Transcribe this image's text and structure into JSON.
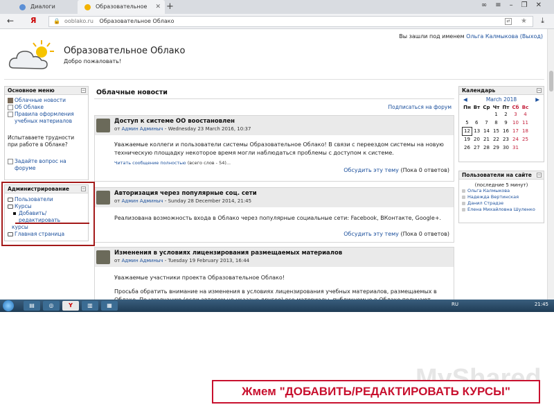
{
  "browser": {
    "tabs": [
      {
        "label": "Диалоги"
      },
      {
        "label": "Образовательное Облако"
      }
    ],
    "address": {
      "brand": "Я",
      "domain": "ooblako.ru",
      "page_title": "Образовательное Облако"
    }
  },
  "header": {
    "login_text": "Вы зашли под именем",
    "user_name": "Ольга Калмыкова",
    "logout": "(Выход)",
    "site_name": "Образовательное Облако",
    "welcome": "Добро пожаловать!"
  },
  "main_menu": {
    "title": "Основное меню",
    "items": [
      {
        "label": "Облачные новости"
      },
      {
        "label": "Об Облаке"
      },
      {
        "label": "Правила оформления учебных материалов"
      }
    ],
    "help_text": "Испытаваете трудности при работе в Облаке?",
    "help_link": "Задайте вопрос на форуме"
  },
  "admin": {
    "title": "Администрирование",
    "users": "Пользователи",
    "courses": "Курсы",
    "add_edit_courses_part1": "Добавить/редактировать",
    "add_edit_courses_part2": "курсы",
    "home": "Главная страница"
  },
  "news": {
    "title": "Облачные новости",
    "subscribe": "Подписаться на форум",
    "posts": [
      {
        "title": "Доступ к системе ОО воостановлен",
        "author": "Админ Админыч",
        "date": "Wednesday 23 March 2016, 10:37",
        "body": "Уважаемые коллеги и пользователи системы Образовательное Облако! В связи с переездом системы на новую техническую площадку некоторое время могли наблюдаться проблемы с доступом к системе.",
        "read_full": "Читать сообщение полностью",
        "words": "(всего слов - 54)...",
        "discuss": "Обсудить эту тему",
        "replies": "(Пока 0 ответов)"
      },
      {
        "title": "Авторизация через популярные соц. сети",
        "author": "Админ Админыч",
        "date": "Sunday 28 December 2014, 21:45",
        "body": "Реализована возможность входа в Облако через популярные социальные сети: Facebook, ВКонтакте, Google+.",
        "discuss": "Обсудить эту тему",
        "replies": "(Пока 0 ответов)"
      },
      {
        "title": "Изменения в условиях лицензирования размещаемых материалов",
        "author": "Админ Админыч",
        "date": "Tuesday 19 February 2013, 16:44",
        "body1": "Уважаемые участники проекта Образовательное Облако!",
        "body2": "Просьба обратить внимание на изменения в условиях лицензирования учебных материалов, размещаемых в Облаке. По умолчанию (если автором не указано другое) все материалы, публикуемые в Облаке получают"
      }
    ],
    "from_label": "от",
    "dash": "-"
  },
  "calendar": {
    "title": "Календарь",
    "month": "March 2018",
    "days": [
      "Пн",
      "Вт",
      "Ср",
      "Чт",
      "Пт",
      "Сб",
      "Вс"
    ],
    "weeks": [
      [
        "",
        "",
        "",
        "1",
        "2",
        "3",
        "4"
      ],
      [
        "5",
        "6",
        "7",
        "8",
        "9",
        "10",
        "11"
      ],
      [
        "12",
        "13",
        "14",
        "15",
        "16",
        "17",
        "18"
      ],
      [
        "19",
        "20",
        "21",
        "22",
        "23",
        "24",
        "25"
      ],
      [
        "26",
        "27",
        "28",
        "29",
        "30",
        "31",
        ""
      ]
    ],
    "today": "12"
  },
  "online": {
    "title": "Пользователи на сайте",
    "subtitle": "(последние 5 минут)",
    "users": [
      "Ольга Калмыкова",
      "Надежда Вертинская",
      "Данил Страдзе",
      "Елена Михайловна Шуленко"
    ]
  },
  "taskbar": {
    "lang": "RU",
    "clock": "21:45"
  },
  "caption": "Жмем \"ДОБАВИТЬ/РЕДАКТИРОВАТЬ КУРСЫ\"",
  "watermark": "MyShared"
}
